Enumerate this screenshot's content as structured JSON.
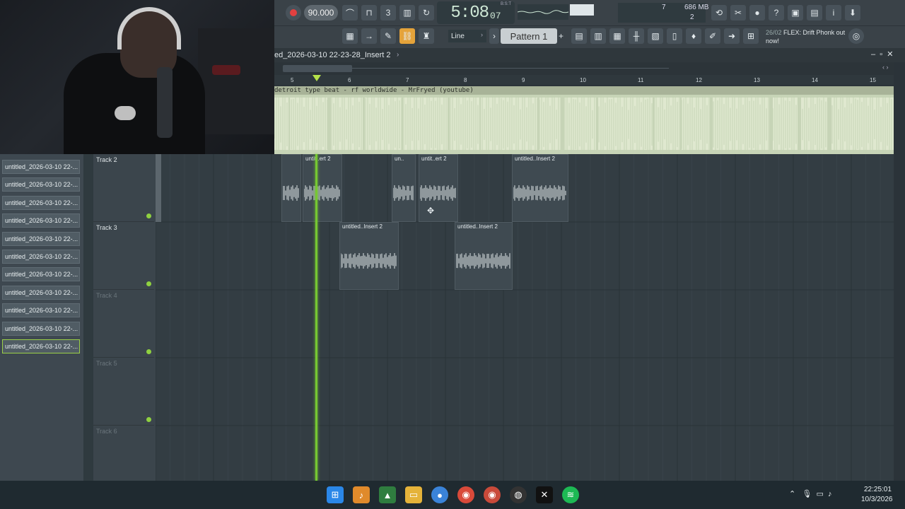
{
  "toolbar": {
    "tempo": "90.000",
    "time_main": "5:08",
    "time_sub": "07",
    "bst_label": "B:S:T",
    "cpu_value": "7",
    "ram": "686 MB",
    "polyphony": "2",
    "pattern_label": "Pattern 1",
    "pattern_add": "+",
    "snap_label": "Line",
    "flex_date": "26/02",
    "flex_text": "FLEX: Drift Phonk out now!"
  },
  "playlist": {
    "title": "ed_2026-03-10 22-23-28_Insert 2",
    "ruler": [
      "5",
      "6",
      "7",
      "8",
      "9",
      "10",
      "11",
      "12",
      "13",
      "14",
      "15"
    ],
    "ref_clip_label": "detroit type beat - rf worldwide - MrFryed (youtube)"
  },
  "files": [
    "untitled_2026-03-10 22-...",
    "untitled_2026-03-10 22-...",
    "untitled_2026-03-10 22-...",
    "untitled_2026-03-10 22-...",
    "untitled_2026-03-10 22-...",
    "untitled_2026-03-10 22-...",
    "untitled_2026-03-10 22-...",
    "untitled_2026-03-10 22-...",
    "untitled_2026-03-10 22-...",
    "untitled_2026-03-10 22-...",
    "untitled_2026-03-10 22-..."
  ],
  "tracks": [
    "Track 2",
    "Track 3",
    "Track 4",
    "Track 5",
    "Track 6"
  ],
  "clips": {
    "t2_a": "",
    "t2_b": "untit..ert 2",
    "t2_c": "un..",
    "t2_d": "untit..ert 2",
    "t2_e": "untitled..Insert 2",
    "t3_a": "untitled..Insert 2",
    "t3_b": "untitled..Insert 2"
  },
  "taskbar": {
    "time": "22:25:01",
    "date": "10/3/2026"
  },
  "colors": {
    "accent_green": "#8fd140",
    "record_red": "#e24040",
    "ref_clip": "#c7d4b7"
  }
}
